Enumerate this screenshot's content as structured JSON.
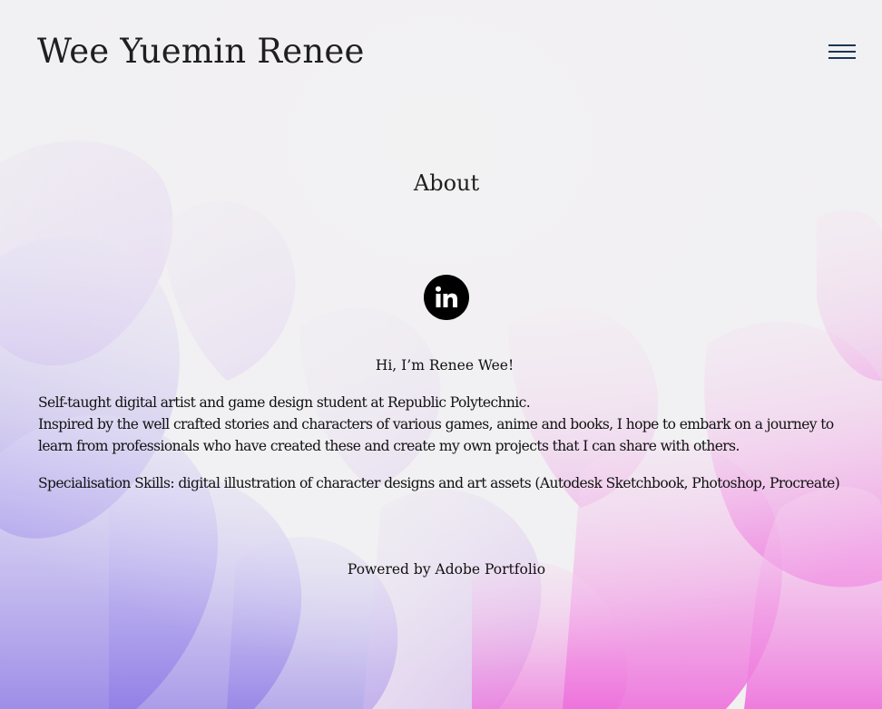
{
  "header": {
    "site_title": "Wee Yuemin Renee",
    "menu_icon": "hamburger-menu-icon"
  },
  "main": {
    "heading": "About",
    "social": {
      "icon": "linkedin-icon"
    },
    "greeting": "Hi, I’m Renee Wee!",
    "bio_lines": [
      "Self-taught digital artist and game design student at Republic Polytechnic.",
      "Inspired by the well crafted stories and characters of various games, anime and books, I hope to embark on a journey to learn from professionals who have created these and create my own projects that I can share with others."
    ],
    "skills": "Specialisation Skills: digital illustration of character designs and art assets (Autodesk Sketchbook, Photoshop, Procreate)"
  },
  "footer": {
    "powered_prefix": "Powered by ",
    "powered_link": "Adobe Portfolio"
  },
  "colors": {
    "background": "#f1f0f1",
    "petal_purple": "#9a86ec",
    "petal_pink": "#f07ae0",
    "menu_icon": "#1d3557",
    "text": "#111111"
  }
}
